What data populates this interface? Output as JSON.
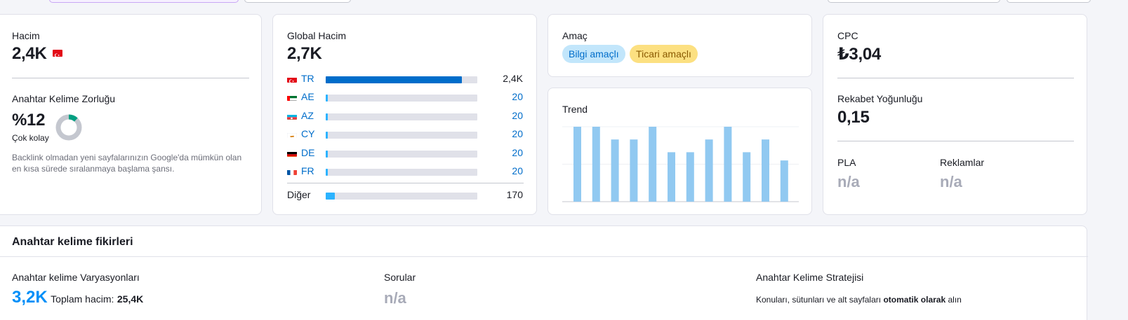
{
  "volume": {
    "label": "Hacim",
    "value": "2,4K",
    "flag_icon": "turkey-flag-icon"
  },
  "kd": {
    "label": "Anahtar Kelime Zorluğu",
    "value": "%12",
    "difficulty_text": "Çok kolay",
    "percent": 12,
    "description": "Backlink olmadan yeni sayfalarınızın Google'da mümkün olan en kısa sürede sıralanmaya başlama şansı.",
    "colors": {
      "filled": "#009f81",
      "empty": "#c4c7cf"
    }
  },
  "global_volume": {
    "label": "Global Hacim",
    "value": "2,7K",
    "countries": [
      {
        "code": "TR",
        "value": "2,4K",
        "share": 0.9,
        "flag": "turkey-flag-icon"
      },
      {
        "code": "AE",
        "value": "20",
        "share": 0.01,
        "flag": "uae-flag-icon"
      },
      {
        "code": "AZ",
        "value": "20",
        "share": 0.01,
        "flag": "azerbaijan-flag-icon"
      },
      {
        "code": "CY",
        "value": "20",
        "share": 0.01,
        "flag": "cyprus-flag-icon"
      },
      {
        "code": "DE",
        "value": "20",
        "share": 0.01,
        "flag": "germany-flag-icon"
      },
      {
        "code": "FR",
        "value": "20",
        "share": 0.01,
        "flag": "france-flag-icon"
      }
    ],
    "other_label": "Diğer",
    "other_value": "170",
    "other_share": 0.06,
    "colors": {
      "tr_bar": "#006dca",
      "bar": "#2bb3ff",
      "track": "#e0e1e9"
    }
  },
  "intent": {
    "label": "Amaç",
    "badges": [
      {
        "text": "Bilgi amaçlı",
        "bg": "#c2e6fb",
        "fg": "#006dca"
      },
      {
        "text": "Ticari amaçlı",
        "bg": "#fce081",
        "fg": "#8a5a00"
      }
    ]
  },
  "trend": {
    "label": "Trend",
    "values": [
      1.0,
      1.0,
      0.83,
      0.83,
      1.0,
      0.66,
      0.66,
      0.83,
      1.0,
      0.66,
      0.83,
      0.55
    ],
    "bar_color": "#91c9f1"
  },
  "cpc": {
    "label": "CPC",
    "value": "₺3,04"
  },
  "competition": {
    "label": "Rekabet Yoğunluğu",
    "value": "0,15"
  },
  "pla": {
    "label": "PLA",
    "value": "n/a"
  },
  "ads": {
    "label": "Reklamlar",
    "value": "n/a"
  },
  "ideas": {
    "title": "Anahtar kelime fikirleri",
    "variations_label": "Anahtar kelime Varyasyonları",
    "variations_value": "3,2K",
    "total_volume_label": "Toplam hacim:",
    "total_volume_value": "25,4K",
    "questions_label": "Sorular",
    "questions_value": "n/a",
    "strategy_label": "Anahtar Kelime Stratejisi",
    "strategy_text_before": "Konuları, sütunları ve alt sayfaları",
    "strategy_text_bold": "otomatik olarak",
    "strategy_text_after": "alın"
  }
}
